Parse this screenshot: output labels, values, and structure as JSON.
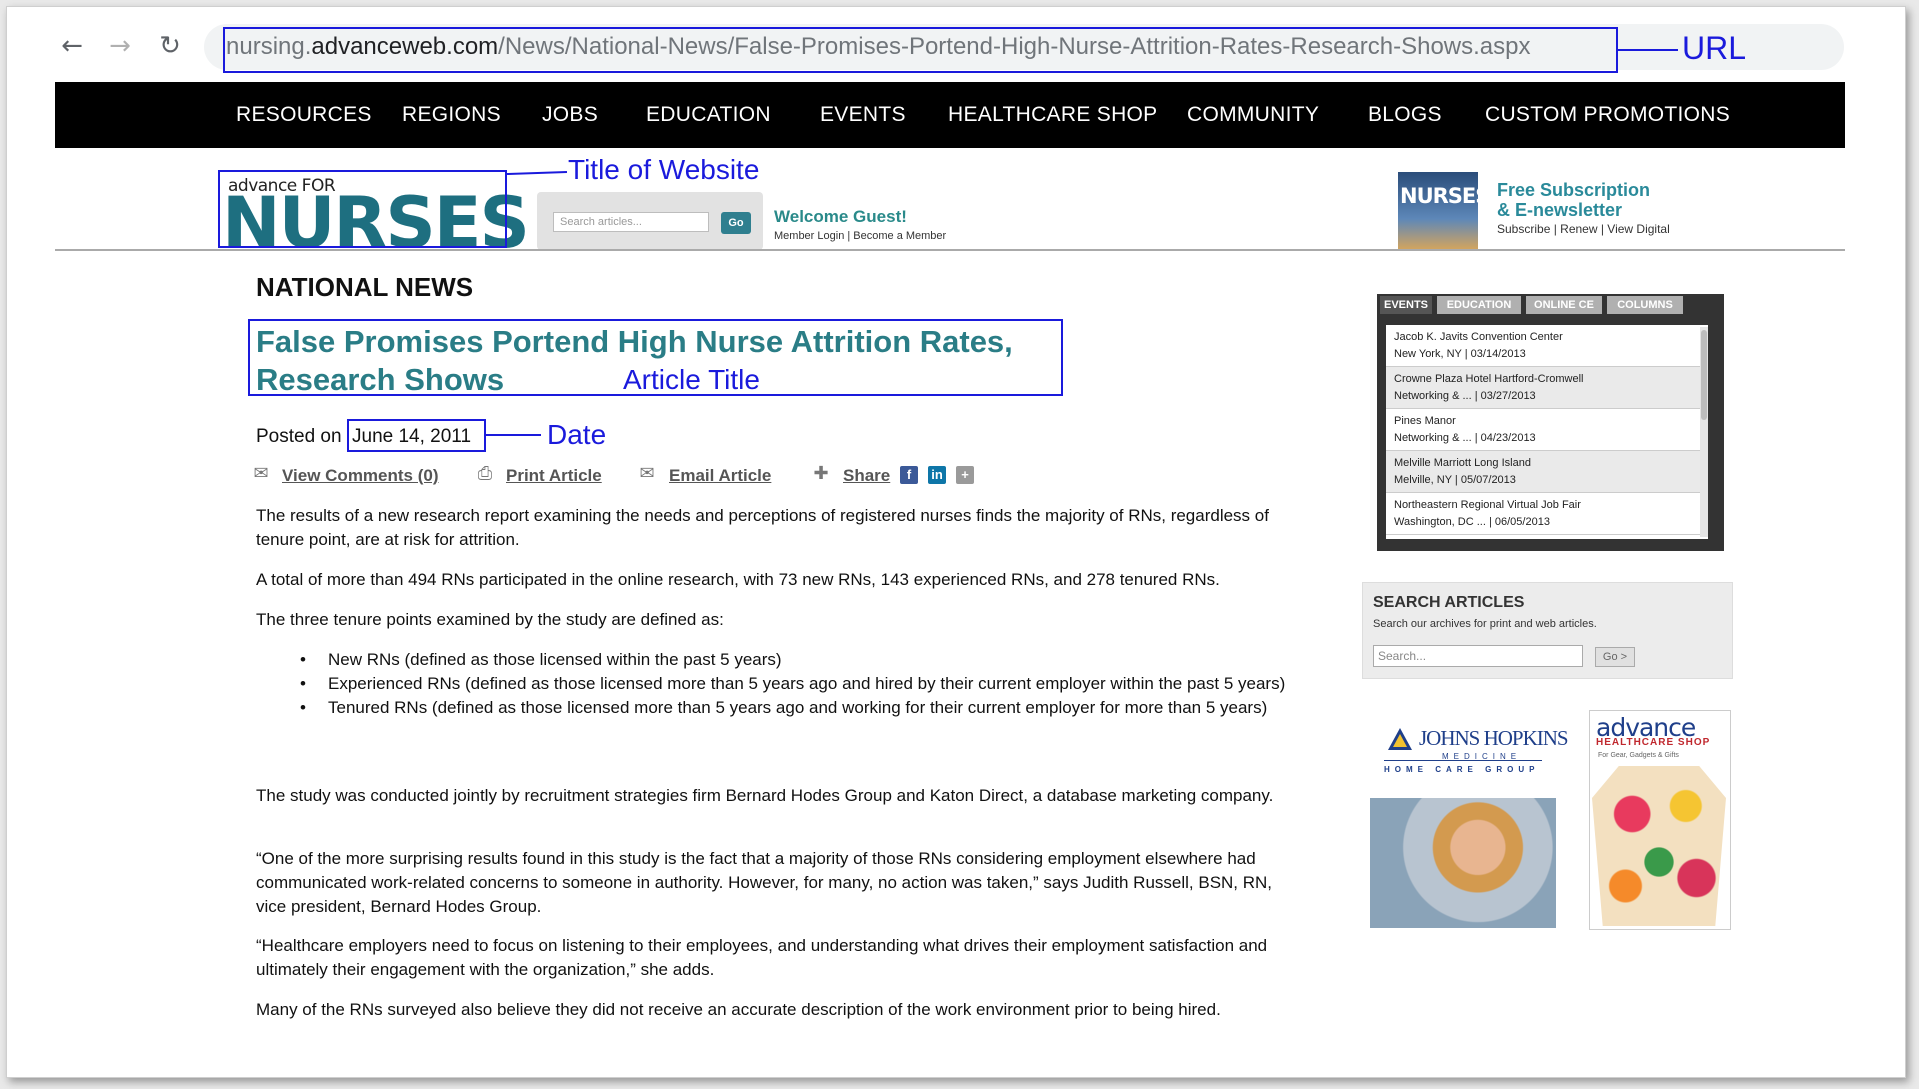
{
  "browser": {
    "url_prefix": "nursing.",
    "url_domain": "advanceweb.com",
    "url_path": "/News/National-News/False-Promises-Portend-High-Nurse-Attrition-Rates-Research-Shows.aspx"
  },
  "annotations": {
    "url": "URL",
    "title_of_website": "Title of Website",
    "article_title": "Article Title",
    "date": "Date"
  },
  "nav": [
    "RESOURCES",
    "REGIONS",
    "JOBS",
    "EDUCATION",
    "EVENTS",
    "HEALTHCARE SHOP",
    "COMMUNITY",
    "BLOGS",
    "CUSTOM PROMOTIONS"
  ],
  "header": {
    "logo_small": "advance FOR",
    "logo_big": "NURSES",
    "search_placeholder": "Search articles...",
    "go": "Go",
    "welcome": "Welcome Guest!",
    "member_links": "Member Login | Become a Member",
    "cover_title": "NURSES",
    "subscription_line1": "Free Subscription",
    "subscription_line2": "& E-newsletter",
    "subscription_links": "Subscribe | Renew | View Digital"
  },
  "article": {
    "section": "NATIONAL NEWS",
    "title": "False Promises Portend High Nurse Attrition Rates, Research Shows",
    "posted_label": "Posted on",
    "date": "June 14, 2011",
    "tools": {
      "comments": "View Comments (0)",
      "print": "Print Article",
      "email": "Email Article",
      "share": "Share"
    },
    "p1": "The results of a new research report examining the needs and perceptions of registered nurses finds the majority of RNs, regardless of tenure point, are at risk for attrition.",
    "p2": "A total of more than 494 RNs participated in the online research, with 73 new RNs, 143 experienced RNs, and 278 tenured RNs.",
    "p3": "The three tenure points examined by the study are defined as:",
    "bullets": [
      "New RNs (defined as those licensed within the past 5 years)",
      "Experienced RNs (defined as those licensed more than 5 years ago and hired by their current employer within the past 5 years)",
      "Tenured RNs (defined as those licensed more than 5 years ago and working for their current employer for more than 5 years)"
    ],
    "p4": "The study was conducted jointly by recruitment strategies firm Bernard Hodes Group and Katon Direct, a database marketing company.",
    "p5": "“One of the more surprising results found in this study is the fact that a majority of those RNs considering employment elsewhere had communicated work-related concerns to someone in authority. However, for many, no action was taken,” says Judith Russell, BSN, RN, vice president, Bernard Hodes Group.",
    "p6": "“Healthcare employers need to focus on listening to their employees, and understanding what drives their employment satisfaction and ultimately their engagement with the organization,” she adds.",
    "p7": "Many of the RNs surveyed also believe they did not receive an accurate description of the work environment prior to being hired."
  },
  "sidebar": {
    "tabs": [
      "EVENTS",
      "EDUCATION",
      "ONLINE CE",
      "COLUMNS"
    ],
    "events": [
      {
        "venue": "Jacob K. Javits Convention Center",
        "place": "New York, NY",
        "date": "03/14/2013"
      },
      {
        "venue": "Crowne Plaza Hotel Hartford-Cromwell",
        "place": "Networking & ...",
        "date": "03/27/2013"
      },
      {
        "venue": "Pines Manor",
        "place": "Networking & ...",
        "date": "04/23/2013"
      },
      {
        "venue": "Melville Marriott Long Island",
        "place": "Melville, NY",
        "date": "05/07/2013"
      },
      {
        "venue": "Northeastern Regional Virtual Job Fair",
        "place": "Washington, DC ...",
        "date": "06/05/2013"
      }
    ],
    "search_title": "SEARCH ARTICLES",
    "search_sub": "Search our archives for print and web articles.",
    "search_placeholder": "Search...",
    "search_go": "Go >",
    "ad1_name": "JOHNS HOPKINS",
    "ad1_medicine": "MEDICINE",
    "ad1_hcg": "HOME CARE GROUP",
    "ad2_name": "advance",
    "ad2_shop": "HEALTHCARE SHOP",
    "ad2_sub": "For Gear, Gadgets & Gifts"
  }
}
